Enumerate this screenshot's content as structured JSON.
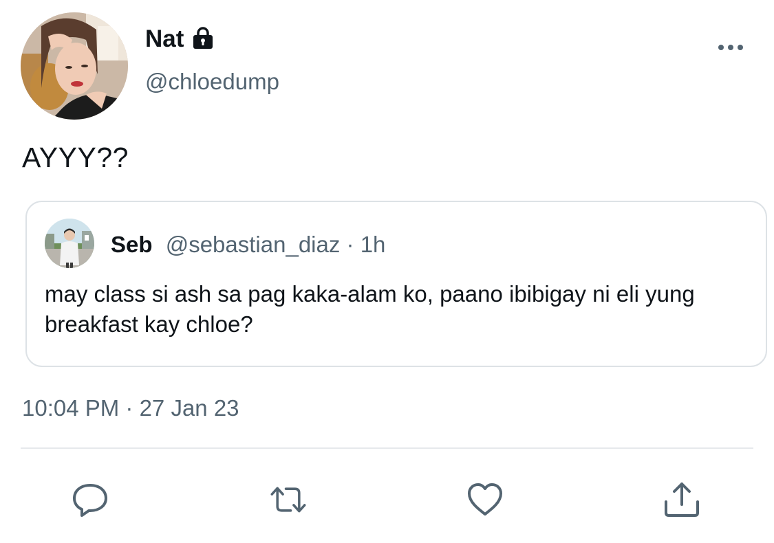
{
  "tweet": {
    "author": {
      "display_name": "Nat",
      "handle": "@chloedump",
      "protected_icon": "lock-icon"
    },
    "text": "AYYY??",
    "timestamp": "10:04 PM · 27 Jan 23",
    "more_icon": "more-horizontal-icon"
  },
  "quoted": {
    "display_name": "Seb",
    "handle": "@sebastian_diaz",
    "separator": " · ",
    "time": "1h",
    "text": "may class si ash sa pag kaka-alam ko, paano ibibigay ni eli yung breakfast kay chloe?"
  },
  "actions": [
    {
      "icon": "reply-icon"
    },
    {
      "icon": "retweet-icon"
    },
    {
      "icon": "like-icon"
    },
    {
      "icon": "share-icon"
    }
  ],
  "colors": {
    "text_primary": "#0f1419",
    "text_secondary": "#536471",
    "border": "#dde2e6",
    "icon": "#536471"
  }
}
